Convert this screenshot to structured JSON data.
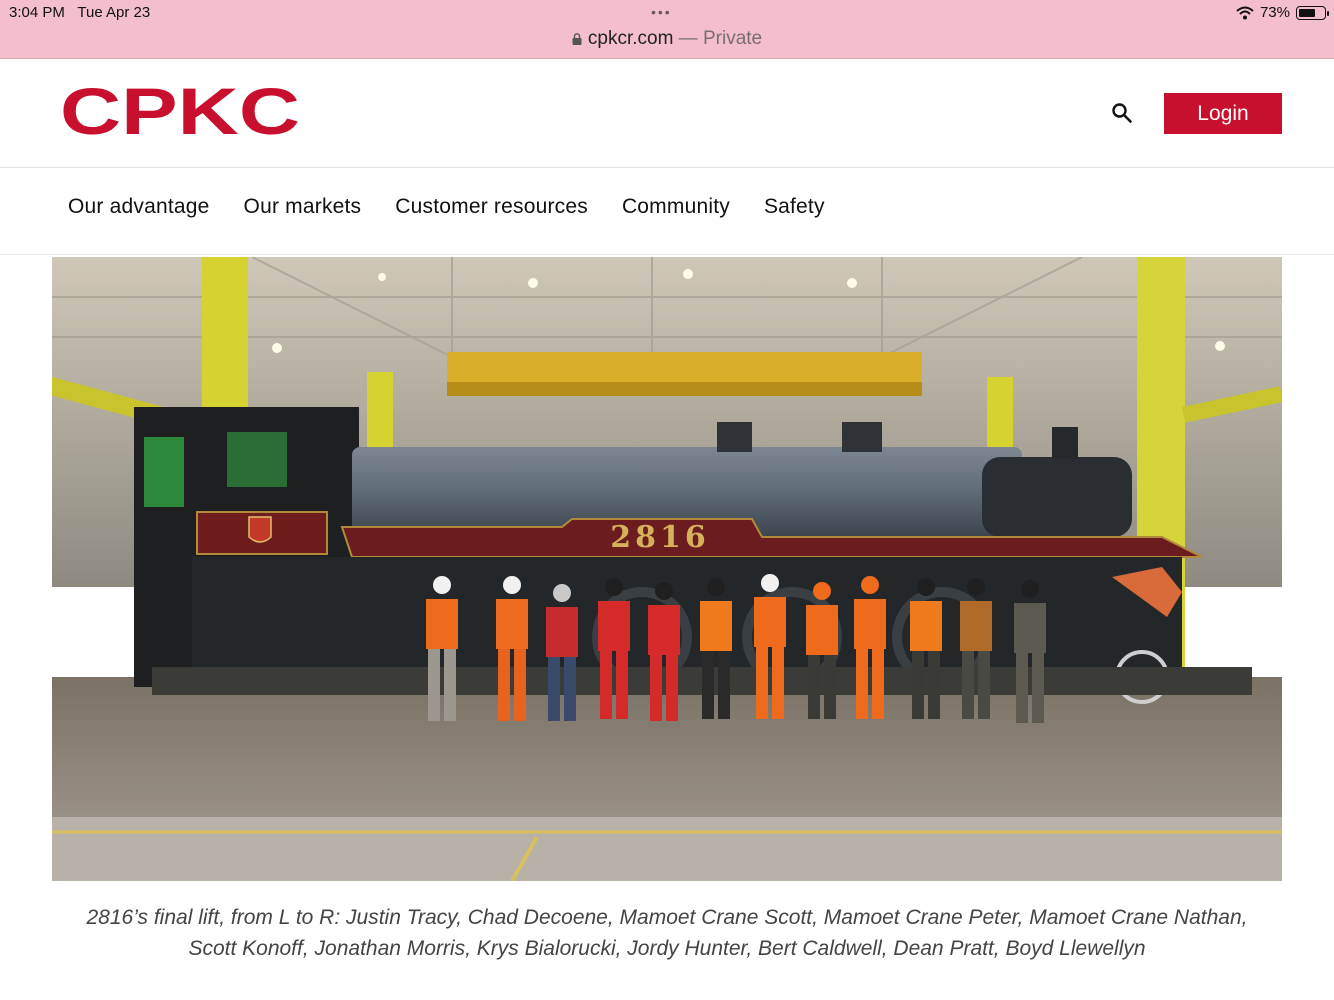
{
  "status": {
    "time": "3:04 PM",
    "date": "Tue Apr 23",
    "battery": "73%",
    "battery_level": 0.73
  },
  "browser": {
    "domain": "cpkcr.com",
    "separator": " — ",
    "mode": "Private"
  },
  "header": {
    "logo_text": "CPKC",
    "login_label": "Login",
    "brand_color": "#c8102e"
  },
  "nav": {
    "items": [
      "Our advantage",
      "Our markets",
      "Customer resources",
      "Community",
      "Safety"
    ]
  },
  "hero": {
    "locomotive_number": "2816"
  },
  "caption": {
    "line1": "2816’s final lift, from L to R: Justin Tracy, Chad Decoene, Mamoet Crane Scott, Mamoet Crane Peter, Mamoet Crane Nathan,",
    "line2": "Scott Konoff, Jonathan Morris, Krys Bialorucki, Jordy Hunter, Bert Caldwell, Dean Pratt, Boyd Llewellyn"
  },
  "icons": {
    "search": "search-icon",
    "lock": "lock-icon",
    "wifi": "wifi-icon",
    "battery": "battery-icon"
  }
}
